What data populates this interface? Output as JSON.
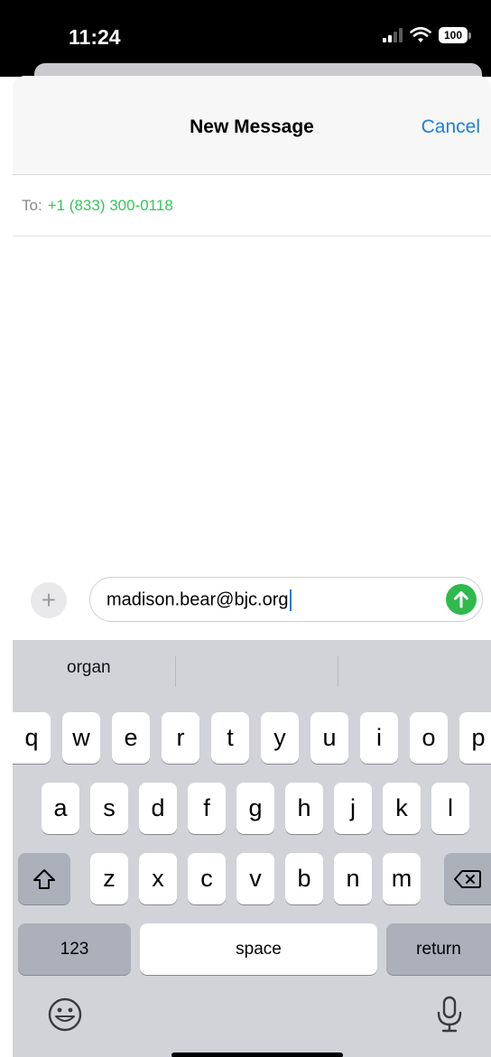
{
  "status": {
    "time": "11:24",
    "battery": "100",
    "icons": [
      "signal-icon",
      "wifi-icon",
      "battery-icon"
    ]
  },
  "nav": {
    "title": "New Message",
    "cancel": "Cancel"
  },
  "recipient": {
    "label": "To:",
    "value": "+1 (833) 300-0118"
  },
  "compose": {
    "plus": "+",
    "text": "madison.bear@bjc.org",
    "send_icon": "send-arrow-icon"
  },
  "keyboard": {
    "suggestions": [
      "organ",
      "",
      ""
    ],
    "row1": [
      "q",
      "w",
      "e",
      "r",
      "t",
      "y",
      "u",
      "i",
      "o",
      "p"
    ],
    "row2": [
      "a",
      "s",
      "d",
      "f",
      "g",
      "h",
      "j",
      "k",
      "l"
    ],
    "row3": [
      "z",
      "x",
      "c",
      "v",
      "b",
      "n",
      "m"
    ],
    "numbers": "123",
    "space": "space",
    "return": "return",
    "bottom_icons": [
      "emoji-icon",
      "microphone-icon"
    ]
  },
  "colors": {
    "accent": "#1a7fe0",
    "recipient": "#34c759",
    "send": "#30b94d",
    "keyboard_bg": "#d1d3d9"
  }
}
